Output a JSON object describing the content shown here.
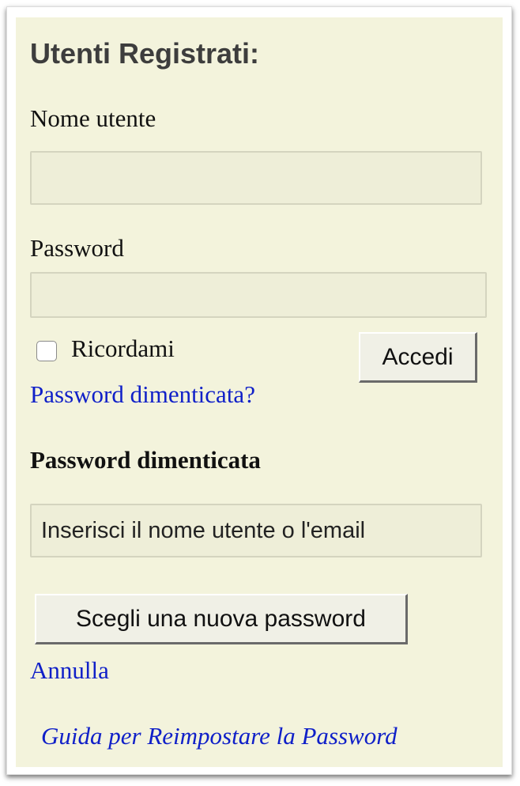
{
  "login": {
    "heading": "Utenti Registrati:",
    "username_label": "Nome utente",
    "username_value": "",
    "password_label": "Password",
    "password_value": "",
    "remember_label": "Ricordami",
    "remember_checked": false,
    "login_button": "Accedi",
    "forgot_link": "Password dimenticata?"
  },
  "forgot": {
    "heading": "Password dimenticata",
    "input_placeholder": "Inserisci il nome utente o l'email",
    "submit_button": "Scegli una nuova password",
    "cancel_link": "Annulla",
    "guide_link": "Guida per Reimpostare la Password"
  },
  "colors": {
    "panel_background": "#f3f3dc",
    "link": "#1020c8",
    "heading": "#3d3d3d"
  }
}
